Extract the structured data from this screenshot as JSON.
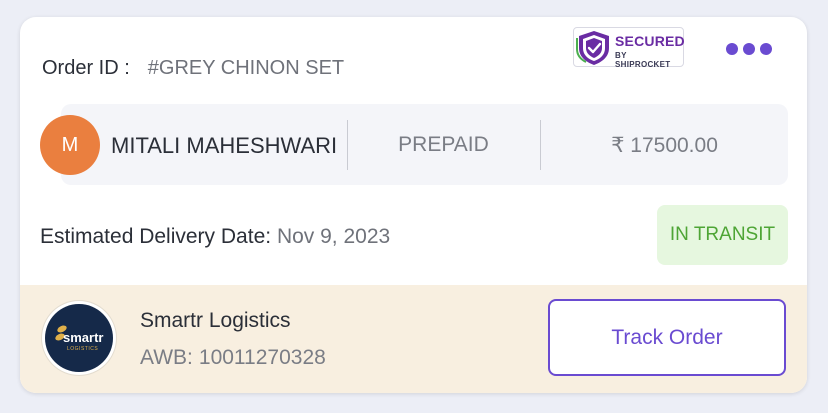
{
  "order": {
    "id_label": "Order ID :",
    "id_value": "#GREY CHINON SET"
  },
  "badge": {
    "line1": "SECURED",
    "line2": "BY SHIPROCKET",
    "icon": "shield-check-icon"
  },
  "menu": {
    "icon": "more-dots-icon"
  },
  "customer": {
    "initial": "M",
    "name": "MITALI MAHESHWARI",
    "payment_mode": "PREPAID",
    "amount": "₹ 17500.00",
    "avatar_color": "#ea7f3f"
  },
  "delivery": {
    "label": "Estimated Delivery Date:",
    "date": "Nov 9, 2023"
  },
  "status": {
    "text": "IN TRANSIT",
    "color": "#4ea535",
    "bg": "#e6f7df"
  },
  "shipping": {
    "courier": "Smartr Logistics",
    "awb_label": "AWB:",
    "awb_number": "10011270328",
    "logo_word": "smartr",
    "logo_sub": "LOGISTICS",
    "track_label": "Track Order"
  },
  "colors": {
    "accent": "#6a4bd1",
    "footer_bg": "#f8efe0",
    "badge_purple": "#6a2ca3"
  }
}
